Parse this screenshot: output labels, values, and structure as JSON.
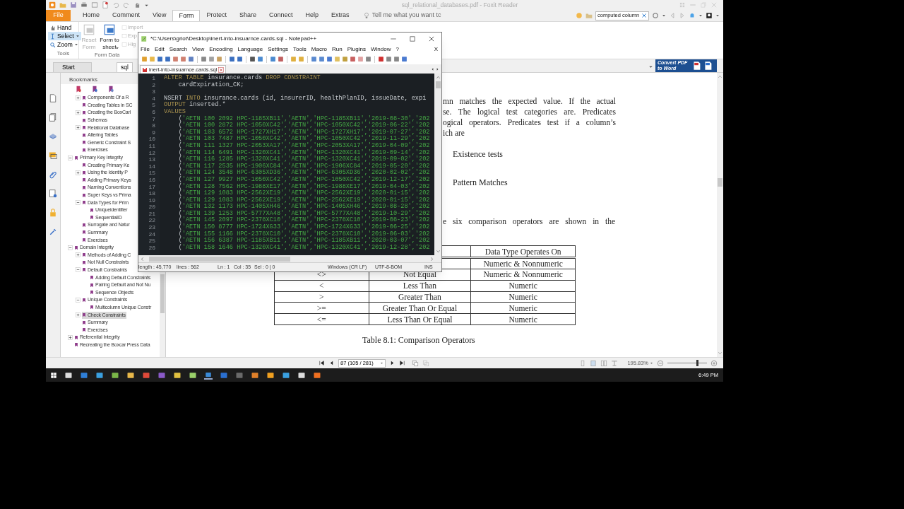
{
  "foxit": {
    "title": "sql_relational_databases.pdf - Foxit Reader",
    "ribbon_tabs": [
      {
        "label": "File",
        "kind": "file",
        "selected": false
      },
      {
        "label": "Home",
        "kind": "tab",
        "selected": false
      },
      {
        "label": "Comment",
        "kind": "tab",
        "selected": false
      },
      {
        "label": "View",
        "kind": "tab",
        "selected": false
      },
      {
        "label": "Form",
        "kind": "tab",
        "selected": true
      },
      {
        "label": "Protect",
        "kind": "tab",
        "selected": false
      },
      {
        "label": "Share",
        "kind": "tab",
        "selected": false
      },
      {
        "label": "Connect",
        "kind": "tab",
        "selected": false
      },
      {
        "label": "Help",
        "kind": "tab",
        "selected": false
      },
      {
        "label": "Extras",
        "kind": "tab",
        "selected": false
      }
    ],
    "tell_me": {
      "placeholder": "Tell me what you want tc"
    },
    "search": {
      "value": "computed column"
    },
    "tools_group": {
      "label": "Tools",
      "items": [
        {
          "label": "Hand",
          "selected": false,
          "dropdown": false
        },
        {
          "label": "Select",
          "selected": true,
          "dropdown": true
        },
        {
          "label": "Zoom",
          "selected": false,
          "dropdown": true
        }
      ]
    },
    "form_data_group": {
      "label": "Form Data",
      "large_buttons": [
        {
          "label": "Reset Form",
          "disabled": true,
          "dropdown": false
        },
        {
          "label": "Form to sheet",
          "disabled": false,
          "dropdown": true
        }
      ],
      "small_buttons": [
        {
          "label": "Import",
          "disabled": true
        },
        {
          "label": "Exp",
          "disabled": true
        },
        {
          "label": "Hig",
          "disabled": true
        }
      ]
    },
    "doc_tabs": [
      {
        "label": "Start",
        "selected": false
      },
      {
        "label": "sql",
        "selected": true
      }
    ],
    "convert_banner": "Convert PDF to Word",
    "bookmarks": {
      "title": "Bookmarks",
      "items": [
        {
          "children": [
            {
              "label": "Components Of a R",
              "expanded": false,
              "selected": false
            },
            {
              "label": "Creating Tables in SC",
              "selected": false
            },
            {
              "label": "Creating the BoxCarl",
              "expanded": false,
              "selected": false
            },
            {
              "label": "Schemas",
              "selected": false
            },
            {
              "label": "Relational Database",
              "expanded": false,
              "selected": false
            },
            {
              "label": "Altering Tables",
              "selected": false
            },
            {
              "label": "Generic Constraint S",
              "selected": false
            },
            {
              "label": "Exercises",
              "selected": false
            }
          ]
        },
        {
          "label": "Primary Key Integrity",
          "expanded": true,
          "selected": false,
          "children": [
            {
              "label": "Creating Primary Ke",
              "selected": false
            },
            {
              "label": "Using the Identity P",
              "expanded": false,
              "selected": false
            },
            {
              "label": "Adding Primary Keys",
              "selected": false
            },
            {
              "label": "Naming Conventions",
              "selected": false
            },
            {
              "label": "Super Keys vs Prima",
              "selected": false
            },
            {
              "label": "Data Types for Prim",
              "expanded": true,
              "selected": false,
              "children": [
                {
                  "label": "Uniqueidentifier",
                  "selected": false
                },
                {
                  "label": "SequentialID",
                  "selected": false
                }
              ]
            },
            {
              "label": "Surrogate and Natur",
              "selected": false
            },
            {
              "label": "Summary",
              "selected": false
            },
            {
              "label": "Exercises",
              "selected": false
            }
          ]
        },
        {
          "label": "Domain Integrity",
          "expanded": true,
          "selected": false,
          "children": [
            {
              "label": "Methods of Adding C",
              "expanded": false,
              "selected": false
            },
            {
              "label": "Not Null Constraints",
              "selected": false
            },
            {
              "label": "Default Constraints",
              "expanded": true,
              "selected": false,
              "children": [
                {
                  "label": "Adding Default Constraints",
                  "selected": false
                },
                {
                  "label": "Pairing Default and Not Nu",
                  "selected": false
                },
                {
                  "label": "Sequence Objects",
                  "selected": false
                }
              ]
            },
            {
              "label": "Unique Constraints",
              "expanded": true,
              "selected": false,
              "children": [
                {
                  "label": "Multicolumn Unique Constr",
                  "selected": false
                }
              ]
            },
            {
              "label": "Check Constraints",
              "expanded": false,
              "selected": true
            },
            {
              "label": "Summary",
              "selected": false
            },
            {
              "label": "Exercises",
              "selected": false
            }
          ]
        },
        {
          "label": "Referential Integrity",
          "expanded": false,
          "selected": false
        },
        {
          "label": "Recreating the Boxcar Press Data",
          "selected": false
        }
      ]
    },
    "page": {
      "paragraph_lines": [
        "mn matches the expected value. If the actual",
        "se. The logical test categories are. Predicates",
        "ogical operators. Predicates test if a column’s",
        "ich are"
      ],
      "list_items": [
        "Existence tests",
        "Pattern Matches"
      ],
      "intro": "e six comparison operators are shown in the",
      "table": {
        "header": {
          "column_3": "Data Type Operates On"
        },
        "rows": [
          {
            "column_3": "Numeric & Nonnumeric"
          },
          {
            "column_1": "<>",
            "column_2": "Not Equal",
            "column_3": "Numeric & Nonnumeric"
          },
          {
            "column_1": "<",
            "column_2": "Less Than",
            "column_3": "Numeric"
          },
          {
            "column_1": ">",
            "column_2": "Greater Than",
            "column_3": "Numeric"
          },
          {
            "column_1": ">=",
            "column_2": "Greater Than Or Equal",
            "column_3": "Numeric"
          },
          {
            "column_1": "<=",
            "column_2": "Less Than Or Equal",
            "column_3": "Numeric"
          }
        ]
      },
      "caption": "Table 8.1: Comparison Operators"
    },
    "nav": {
      "page": "87 (105 / 281)",
      "zoom": "195.83%",
      "zoom_slider": {
        "level": 0.75
      }
    }
  },
  "notepad": {
    "title": "*C:\\Users\\griot\\Desktop\\inert-into-insuarnce.cards.sql - Notepad++",
    "menu": [
      "File",
      "Edit",
      "Search",
      "View",
      "Encoding",
      "Language",
      "Settings",
      "Tools",
      "Macro",
      "Run",
      "Plugins",
      "Window",
      "?"
    ],
    "close_document": "X",
    "tab": {
      "label": "inert-into-insuarnce.cards.sql",
      "modified": true
    },
    "lines": [
      {
        "number": "1",
        "tokens": [
          {
            "kind": "keyword",
            "text": "ALTER TABLE"
          },
          {
            "kind": "plain",
            "text": " insurance.cards "
          },
          {
            "kind": "keyword",
            "text": "DROP CONSTRAINT"
          }
        ]
      },
      {
        "number": "2",
        "tokens": [
          {
            "kind": "plain",
            "text": "    cardExpiration_CK;"
          }
        ]
      },
      {
        "number": "3"
      },
      {
        "number": "4",
        "tokens": [
          {
            "kind": "plain",
            "text": "NSERT "
          },
          {
            "kind": "keyword",
            "text": "INTO"
          },
          {
            "kind": "plain",
            "text": " insurance.cards (id, insurerID, healthPlanID, issueDate, expi"
          }
        ]
      },
      {
        "number": "5",
        "tokens": [
          {
            "kind": "keyword",
            "text": "OUTPUT"
          },
          {
            "kind": "plain",
            "text": " inserted.*"
          }
        ]
      },
      {
        "number": "6",
        "tokens": [
          {
            "kind": "keyword",
            "text": "VALUES"
          }
        ]
      },
      {
        "number": "7",
        "tokens": [
          {
            "kind": "plain",
            "text": "    ("
          },
          {
            "kind": "string",
            "text": "'AETN 100 2092 HPC-1185XB11','AETN','HPC-1185XB11','2019-08-30','202"
          }
        ]
      },
      {
        "number": "8",
        "tokens": [
          {
            "kind": "plain",
            "text": "    ("
          },
          {
            "kind": "string",
            "text": "'AETN 100 2872 HPC-1050XC42','AETN','HPC-1050XC42','2019-06-22','202"
          }
        ]
      },
      {
        "number": "9",
        "tokens": [
          {
            "kind": "plain",
            "text": "    ("
          },
          {
            "kind": "string",
            "text": "'AETN 103 6572 HPC-1727XH17','AETN','HPC-1727XH17','2019-07-27','202"
          }
        ]
      },
      {
        "number": "10",
        "tokens": [
          {
            "kind": "plain",
            "text": "    ("
          },
          {
            "kind": "string",
            "text": "'AETN 103 7487 HPC-1050XC42','AETN','HPC-1050XC42','2019-11-29','202"
          }
        ]
      },
      {
        "number": "11",
        "tokens": [
          {
            "kind": "plain",
            "text": "    ("
          },
          {
            "kind": "string",
            "text": "'AETN 111 1327 HPC-2053XA17','AETN','HPC-2053XA17','2019-04-09','202"
          }
        ]
      },
      {
        "number": "12",
        "tokens": [
          {
            "kind": "plain",
            "text": "    ("
          },
          {
            "kind": "string",
            "text": "'AETN 114 6491 HPC-1320XC41','AETN','HPC-1320XC41','2019-09-14','202"
          }
        ]
      },
      {
        "number": "13",
        "tokens": [
          {
            "kind": "plain",
            "text": "    ("
          },
          {
            "kind": "string",
            "text": "'AETN 116 1285 HPC-1320XC41','AETN','HPC-1320XC41','2019-09-02','202"
          }
        ]
      },
      {
        "number": "14",
        "tokens": [
          {
            "kind": "plain",
            "text": "    ("
          },
          {
            "kind": "string",
            "text": "'AETN 117 2535 HPC-1906XC84','AETN','HPC-1906XC84','2019-05-20','202"
          }
        ]
      },
      {
        "number": "15",
        "tokens": [
          {
            "kind": "plain",
            "text": "    ("
          },
          {
            "kind": "string",
            "text": "'AETN 124 3548 HPC-6305XD36','AETN','HPC-6305XD36','2020-02-02','202"
          }
        ]
      },
      {
        "number": "16",
        "tokens": [
          {
            "kind": "plain",
            "text": "    ("
          },
          {
            "kind": "string",
            "text": "'AETN 127 9927 HPC-1050XC42','AETN','HPC-1050XC42','2019-12-17','202"
          }
        ]
      },
      {
        "number": "17",
        "tokens": [
          {
            "kind": "plain",
            "text": "    ("
          },
          {
            "kind": "string",
            "text": "'AETN 128 7562 HPC-1988XE17','AETN','HPC-1988XE17','2019-04-03','202"
          }
        ]
      },
      {
        "number": "18",
        "tokens": [
          {
            "kind": "plain",
            "text": "    ("
          },
          {
            "kind": "string",
            "text": "'AETN 129 1083 HPC-2562XE19','AETN','HPC-2562XE19','2020-01-15','202"
          }
        ]
      },
      {
        "number": "19",
        "tokens": [
          {
            "kind": "plain",
            "text": "    ("
          },
          {
            "kind": "string",
            "text": "'AETN 129 1083 HPC-2562XE19','AETN','HPC-2562XE19','2020-01-15','202"
          }
        ]
      },
      {
        "number": "20",
        "tokens": [
          {
            "kind": "plain",
            "text": "    ("
          },
          {
            "kind": "string",
            "text": "'AETN 132 1173 HPC-1405XH46','AETN','HPC-1405XH46','2019-08-28','202"
          }
        ]
      },
      {
        "number": "21",
        "tokens": [
          {
            "kind": "plain",
            "text": "    ("
          },
          {
            "kind": "string",
            "text": "'AETN 139 1253 HPC-5777XA48','AETN','HPC-5777XA48','2019-10-29','202"
          }
        ]
      },
      {
        "number": "22",
        "tokens": [
          {
            "kind": "plain",
            "text": "    ("
          },
          {
            "kind": "string",
            "text": "'AETN 145 2097 HPC-2378XC10','AETN','HPC-2378XC10','2019-08-23','202"
          }
        ]
      },
      {
        "number": "23",
        "tokens": [
          {
            "kind": "plain",
            "text": "    ("
          },
          {
            "kind": "string",
            "text": "'AETN 150 8777 HPC-1724XG33','AETN','HPC-1724XG33','2019-06-25','202"
          }
        ]
      },
      {
        "number": "24",
        "tokens": [
          {
            "kind": "plain",
            "text": "    ("
          },
          {
            "kind": "string",
            "text": "'AETN 155 1166 HPC-2378XC10','AETN','HPC-2378XC10','2019-06-03','202"
          }
        ]
      },
      {
        "number": "25",
        "tokens": [
          {
            "kind": "plain",
            "text": "    ("
          },
          {
            "kind": "string",
            "text": "'AETN 156 6387 HPC-1185XB11','AETN','HPC-1185XB11','2020-03-07','202"
          }
        ]
      },
      {
        "number": "26",
        "tokens": [
          {
            "kind": "plain",
            "text": "    ("
          },
          {
            "kind": "string",
            "text": "'AETN 158 1646 HPC-1320XC41','AETN','HPC-1320XC41','2019-12-28','202"
          }
        ]
      }
    ],
    "status": [
      "length : 45,770",
      "lines : 562",
      "Ln : 1",
      "Col : 35",
      "Sel : 0 | 0",
      "Windows (CR LF)",
      "UTF-8-BOM",
      "INS"
    ]
  },
  "taskbar": {
    "time": "6:49 PM"
  }
}
